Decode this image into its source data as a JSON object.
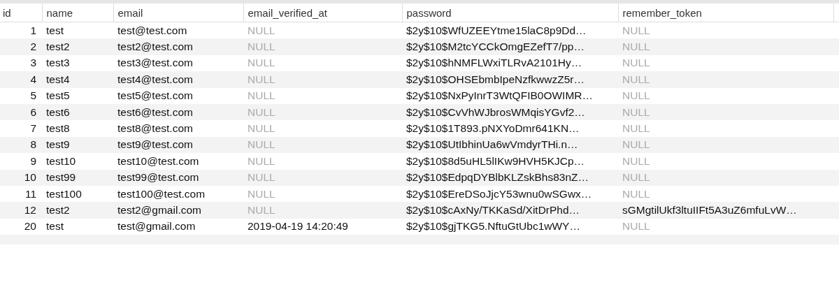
{
  "table": {
    "columns": [
      "id",
      "name",
      "email",
      "email_verified_at",
      "password",
      "remember_token"
    ],
    "rows": [
      [
        {
          "text": "1",
          "null": false
        },
        {
          "text": "test",
          "null": false
        },
        {
          "text": "test@test.com",
          "null": false
        },
        {
          "text": "NULL",
          "null": true
        },
        {
          "text": "$2y$10$WfUZEEYtme15laC8p9Dd…",
          "null": false
        },
        {
          "text": "NULL",
          "null": true
        }
      ],
      [
        {
          "text": "2",
          "null": false
        },
        {
          "text": "test2",
          "null": false
        },
        {
          "text": "test2@test.com",
          "null": false
        },
        {
          "text": "NULL",
          "null": true
        },
        {
          "text": "$2y$10$M2tcYCCkOmgEZefT7/pp…",
          "null": false
        },
        {
          "text": "NULL",
          "null": true
        }
      ],
      [
        {
          "text": "3",
          "null": false
        },
        {
          "text": "test3",
          "null": false
        },
        {
          "text": "test3@test.com",
          "null": false
        },
        {
          "text": "NULL",
          "null": true
        },
        {
          "text": "$2y$10$hNMFLWxiTLRvA2101Hy…",
          "null": false
        },
        {
          "text": "NULL",
          "null": true
        }
      ],
      [
        {
          "text": "4",
          "null": false
        },
        {
          "text": "test4",
          "null": false
        },
        {
          "text": "test4@test.com",
          "null": false
        },
        {
          "text": "NULL",
          "null": true
        },
        {
          "text": "$2y$10$OHSEbmbIpeNzfkwwzZ5r…",
          "null": false
        },
        {
          "text": "NULL",
          "null": true
        }
      ],
      [
        {
          "text": "5",
          "null": false
        },
        {
          "text": "test5",
          "null": false
        },
        {
          "text": "test5@test.com",
          "null": false
        },
        {
          "text": "NULL",
          "null": true
        },
        {
          "text": "$2y$10$NxPyInrT3WtQFIB0OWIMR…",
          "null": false
        },
        {
          "text": "NULL",
          "null": true
        }
      ],
      [
        {
          "text": "6",
          "null": false
        },
        {
          "text": "test6",
          "null": false
        },
        {
          "text": "test6@test.com",
          "null": false
        },
        {
          "text": "NULL",
          "null": true
        },
        {
          "text": "$2y$10$CvVhWJbrosWMqisYGvf2…",
          "null": false
        },
        {
          "text": "NULL",
          "null": true
        }
      ],
      [
        {
          "text": "7",
          "null": false
        },
        {
          "text": "test8",
          "null": false
        },
        {
          "text": "test8@test.com",
          "null": false
        },
        {
          "text": "NULL",
          "null": true
        },
        {
          "text": "$2y$10$1T893.pNXYoDmr641KN…",
          "null": false
        },
        {
          "text": "NULL",
          "null": true
        }
      ],
      [
        {
          "text": "8",
          "null": false
        },
        {
          "text": "test9",
          "null": false
        },
        {
          "text": "test9@test.com",
          "null": false
        },
        {
          "text": "NULL",
          "null": true
        },
        {
          "text": "$2y$10$UtIbhinUa6wVmdyrTHi.n…",
          "null": false
        },
        {
          "text": "NULL",
          "null": true
        }
      ],
      [
        {
          "text": "9",
          "null": false
        },
        {
          "text": "test10",
          "null": false
        },
        {
          "text": "test10@test.com",
          "null": false
        },
        {
          "text": "NULL",
          "null": true
        },
        {
          "text": "$2y$10$8d5uHL5lIKw9HVH5KJCp…",
          "null": false
        },
        {
          "text": "NULL",
          "null": true
        }
      ],
      [
        {
          "text": "10",
          "null": false
        },
        {
          "text": "test99",
          "null": false
        },
        {
          "text": "test99@test.com",
          "null": false
        },
        {
          "text": "NULL",
          "null": true
        },
        {
          "text": "$2y$10$EdpqDYBlbKLZskBhs83nZ…",
          "null": false
        },
        {
          "text": "NULL",
          "null": true
        }
      ],
      [
        {
          "text": "11",
          "null": false
        },
        {
          "text": "test100",
          "null": false
        },
        {
          "text": "test100@test.com",
          "null": false
        },
        {
          "text": "NULL",
          "null": true
        },
        {
          "text": "$2y$10$EreDSoJjcY53wnu0wSGwx…",
          "null": false
        },
        {
          "text": "NULL",
          "null": true
        }
      ],
      [
        {
          "text": "12",
          "null": false
        },
        {
          "text": "test2",
          "null": false
        },
        {
          "text": "test2@gmail.com",
          "null": false
        },
        {
          "text": "NULL",
          "null": true
        },
        {
          "text": "$2y$10$cAxNy/TKKaSd/XitDrPhd…",
          "null": false
        },
        {
          "text": "sGMgtilUkf3ltuIIFt5A3uZ6mfuLvW…",
          "null": false
        }
      ],
      [
        {
          "text": "20",
          "null": false
        },
        {
          "text": "test",
          "null": false
        },
        {
          "text": "test@gmail.com",
          "null": false
        },
        {
          "text": "2019-04-19 14:20:49",
          "null": false
        },
        {
          "text": "$2y$10$gjTKG5.NftuGtUbc1wWY…",
          "null": false
        },
        {
          "text": "NULL",
          "null": true
        }
      ]
    ]
  }
}
